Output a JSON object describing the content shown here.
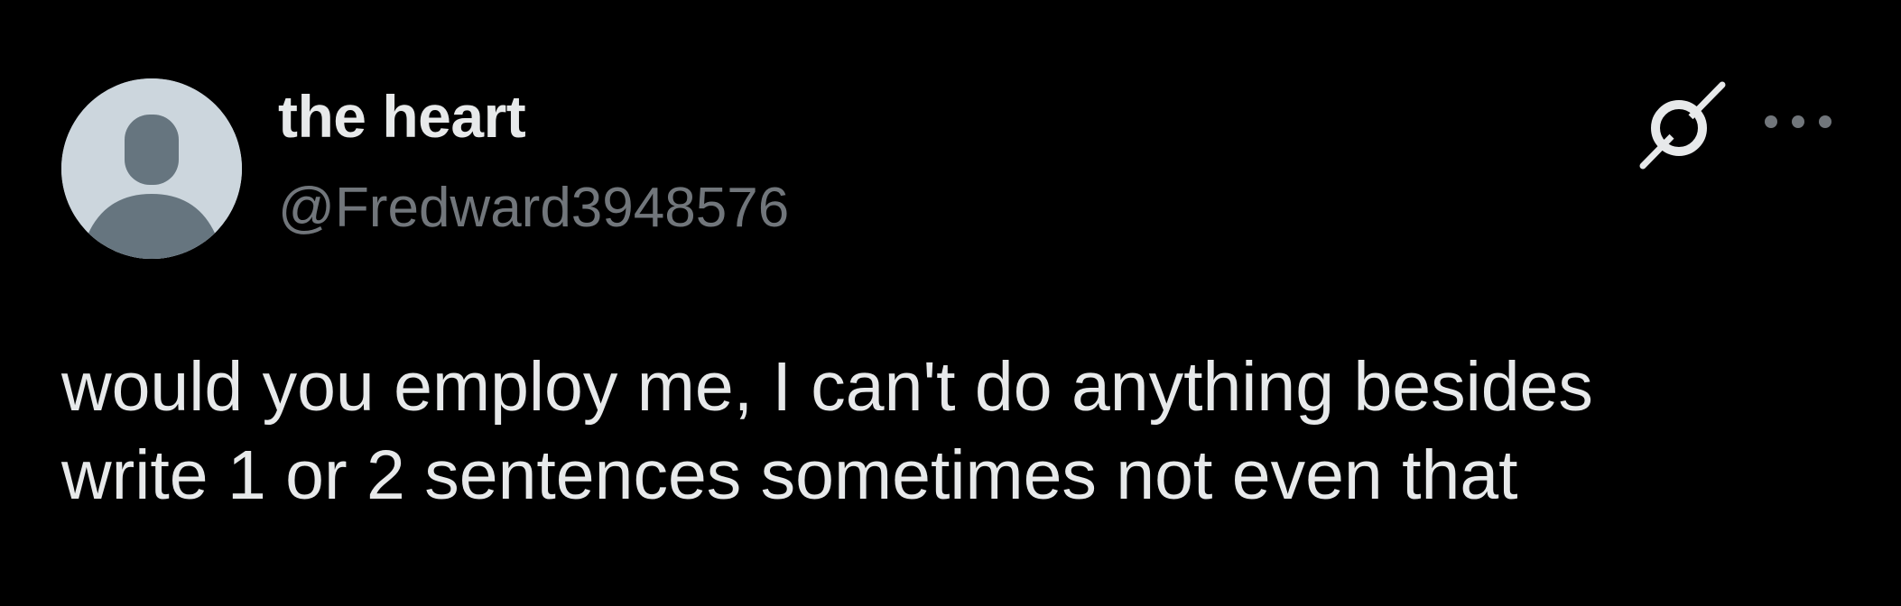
{
  "post": {
    "author": {
      "display_name": "the heart",
      "handle": "@Fredward3948576"
    },
    "text_lines": [
      "would you employ me, I can't do anything besides",
      "write 1 or 2 sentences sometimes not even that"
    ]
  },
  "icons": {
    "avatar": "default-avatar-icon",
    "grok": "grok-icon",
    "more": "more-options-icon"
  },
  "colors": {
    "background": "#000000",
    "primary_text": "#e7e9ea",
    "secondary_text": "#71767b",
    "avatar_bg": "#ccd6dd",
    "avatar_figure": "#66757f"
  }
}
